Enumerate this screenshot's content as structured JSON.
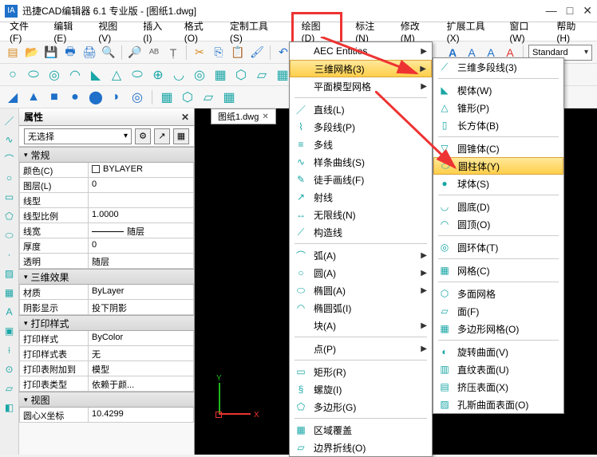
{
  "title": "迅捷CAD编辑器 6.1 专业版 - [图纸1.dwg]",
  "window_controls": {
    "min": "—",
    "max": "□",
    "close": "✕"
  },
  "menubar": [
    "文件(F)",
    "编辑(E)",
    "视图(V)",
    "插入(I)",
    "格式(O)",
    "定制工具(S)",
    "绘图(D)",
    "标注(N)",
    "修改(M)",
    "扩展工具(X)",
    "窗口(W)",
    "帮助(H)"
  ],
  "toolbar_combo": "Standard",
  "tab_label": "图纸1.dwg",
  "panel": {
    "title": "属性",
    "close": "✕",
    "selector": "无选择",
    "sections": {
      "general": {
        "title": "常规",
        "rows": [
          {
            "l": "颜色(C)",
            "r": "BYLAYER",
            "bylayer": true
          },
          {
            "l": "图层(L)",
            "r": "0"
          },
          {
            "l": "线型",
            "r": ""
          },
          {
            "l": "线型比例",
            "r": "1.0000"
          },
          {
            "l": "线宽",
            "r": "随层",
            "line": true
          },
          {
            "l": "厚度",
            "r": "0"
          },
          {
            "l": "透明",
            "r": "随层"
          }
        ]
      },
      "threeD": {
        "title": "三维效果",
        "rows": [
          {
            "l": "材质",
            "r": "ByLayer"
          },
          {
            "l": "阴影显示",
            "r": "投下阴影"
          }
        ]
      },
      "print": {
        "title": "打印样式",
        "rows": [
          {
            "l": "打印样式",
            "r": "ByColor"
          },
          {
            "l": "打印样式表",
            "r": "无"
          },
          {
            "l": "打印表附加到",
            "r": "模型"
          },
          {
            "l": "打印表类型",
            "r": "依赖于颜..."
          }
        ]
      },
      "view": {
        "title": "视图",
        "rows": [
          {
            "l": "圆心X坐标",
            "r": "10.4299"
          }
        ]
      }
    }
  },
  "dropdown1": {
    "items": [
      {
        "label": "AEC Entities",
        "arrow": true
      },
      {
        "label": "三维网格(3)",
        "arrow": true,
        "hl": true
      },
      {
        "label": "平面模型网格",
        "arrow": true
      },
      {
        "sep": true
      },
      {
        "label": "直线(L)",
        "icon": "／"
      },
      {
        "label": "多段线(P)",
        "icon": "⌇"
      },
      {
        "label": "多线",
        "icon": "≡"
      },
      {
        "label": "样条曲线(S)",
        "icon": "∿"
      },
      {
        "label": "徒手画线(F)",
        "icon": "✎"
      },
      {
        "label": "射线",
        "icon": "↗"
      },
      {
        "label": "无限线(N)",
        "icon": "↔"
      },
      {
        "label": "构造线",
        "icon": "⟋"
      },
      {
        "sep": true
      },
      {
        "label": "弧(A)",
        "arrow": true,
        "icon": "⌒"
      },
      {
        "label": "圆(A)",
        "arrow": true,
        "icon": "○"
      },
      {
        "label": "椭圆(A)",
        "arrow": true,
        "icon": "⬭"
      },
      {
        "label": "椭圆弧(I)",
        "icon": "◠"
      },
      {
        "label": "块(A)",
        "arrow": true
      },
      {
        "sep": true
      },
      {
        "label": "点(P)",
        "arrow": true
      },
      {
        "sep": true
      },
      {
        "label": "矩形(R)",
        "icon": "▭"
      },
      {
        "label": "螺旋(I)",
        "icon": "§"
      },
      {
        "label": "多边形(G)",
        "icon": "⬠"
      },
      {
        "sep": true
      },
      {
        "label": "区域覆盖",
        "icon": "▦"
      },
      {
        "label": "边界折线(O)",
        "icon": "▱"
      }
    ]
  },
  "dropdown2": {
    "items": [
      {
        "label": "三维多段线(3)",
        "icon": "⟋"
      },
      {
        "sep": true
      },
      {
        "label": "楔体(W)",
        "icon": "◣"
      },
      {
        "label": "锥形(P)",
        "icon": "△"
      },
      {
        "label": "长方体(B)",
        "icon": "▯"
      },
      {
        "sep": true
      },
      {
        "label": "圆锥体(C)",
        "icon": "▽"
      },
      {
        "label": "圆柱体(Y)",
        "icon": "⬭",
        "hl": true
      },
      {
        "label": "球体(S)",
        "icon": "●"
      },
      {
        "sep": true
      },
      {
        "label": "圆底(D)",
        "icon": "◡"
      },
      {
        "label": "圆顶(O)",
        "icon": "◠"
      },
      {
        "sep": true
      },
      {
        "label": "圆环体(T)",
        "icon": "◎"
      },
      {
        "sep": true
      },
      {
        "label": "网格(C)",
        "icon": "▦"
      },
      {
        "sep": true
      },
      {
        "label": "多面网格",
        "icon": "⬡"
      },
      {
        "label": "面(F)",
        "icon": "▱"
      },
      {
        "label": "多边形网格(O)",
        "icon": "▦"
      },
      {
        "sep": true
      },
      {
        "label": "旋转曲面(V)",
        "icon": "◐"
      },
      {
        "label": "直纹表面(U)",
        "icon": "▥"
      },
      {
        "label": "挤压表面(X)",
        "icon": "▤"
      },
      {
        "label": "孔斯曲面表面(O)",
        "icon": "▨"
      }
    ]
  },
  "axis": {
    "x": "X",
    "y": "Y"
  }
}
